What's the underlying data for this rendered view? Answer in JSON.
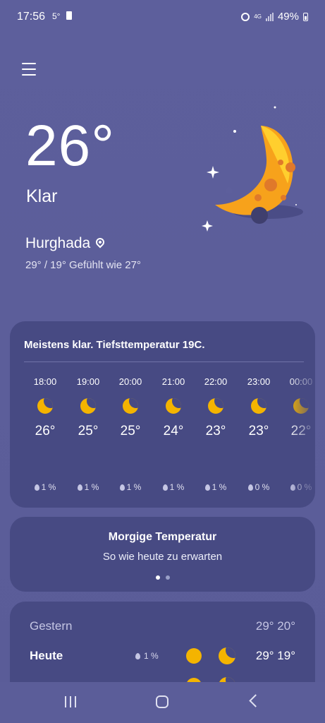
{
  "status_bar": {
    "time": "17:56",
    "temp": "5°",
    "network": "4G",
    "battery": "49%"
  },
  "current": {
    "temperature": "26°",
    "condition": "Klar",
    "city": "Hurghada",
    "minmax_feels": "29° / 19° Gefühlt wie 27°"
  },
  "hourly": {
    "summary": "Meistens klar. Tiefsttemperatur 19C.",
    "items": [
      {
        "time": "18:00",
        "icon": "moon-icon",
        "temp": "26°",
        "rain": "1 %"
      },
      {
        "time": "19:00",
        "icon": "moon-icon",
        "temp": "25°",
        "rain": "1 %"
      },
      {
        "time": "20:00",
        "icon": "moon-icon",
        "temp": "25°",
        "rain": "1 %"
      },
      {
        "time": "21:00",
        "icon": "moon-icon",
        "temp": "24°",
        "rain": "1 %"
      },
      {
        "time": "22:00",
        "icon": "moon-icon",
        "temp": "23°",
        "rain": "1 %"
      },
      {
        "time": "23:00",
        "icon": "moon-icon",
        "temp": "23°",
        "rain": "0 %"
      },
      {
        "time": "00:00",
        "icon": "moon-icon",
        "temp": "22°",
        "rain": "0 %"
      }
    ]
  },
  "tomorrow": {
    "title": "Morgige Temperatur",
    "subtitle": "So wie heute zu erwarten"
  },
  "daily": [
    {
      "name": "Gestern",
      "rain": "",
      "temps": "29° 20°"
    },
    {
      "name": "Heute",
      "rain": "1 %",
      "temps": "29° 19°"
    }
  ],
  "colors": {
    "accent": "#f4b400",
    "card": "#474a83",
    "background": "#5d5f9c"
  }
}
